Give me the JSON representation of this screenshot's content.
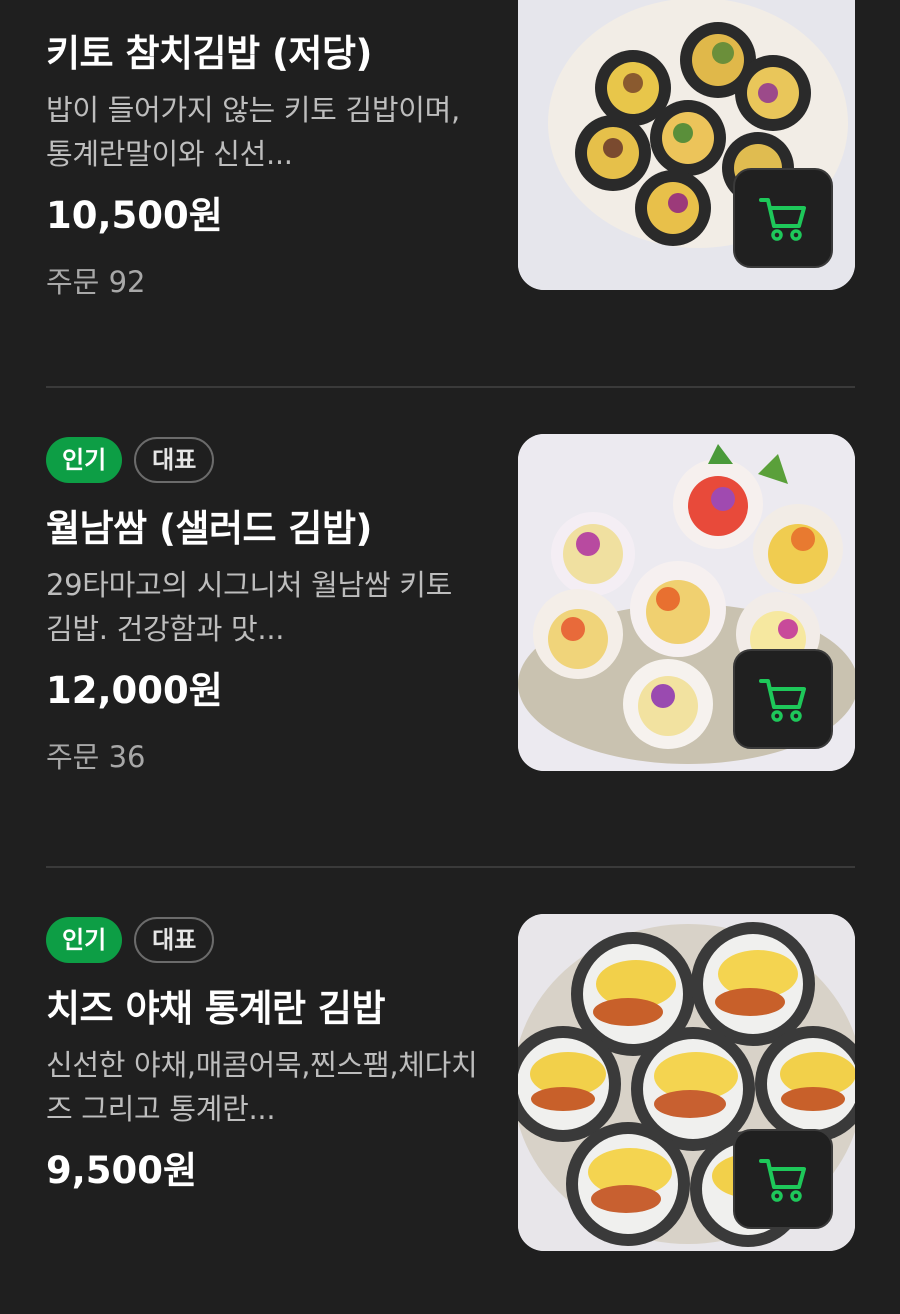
{
  "items": [
    {
      "name": "키토 참치김밥 (저당)",
      "description": "밥이 들어가지 않는 키토 김밥이며, 통계란말이와 신선...",
      "price": "10,500원",
      "orders": "주문 92"
    },
    {
      "badges": [
        "인기",
        "대표"
      ],
      "name": "월남쌈 (샐러드 김밥)",
      "description": "29타마고의 시그니처 월남쌈 키토 김밥. 건강함과 맛...",
      "price": "12,000원",
      "orders": "주문 36"
    },
    {
      "badges": [
        "인기",
        "대표"
      ],
      "name": "치즈 야채 통계란 김밥",
      "description": "신선한 야채,매콤어묵,찐스팸,체다치즈 그리고 통계란...",
      "price": "9,500원"
    }
  ],
  "icons": {
    "cart": "shopping-cart-icon"
  },
  "colors": {
    "accent": "#0d9e45",
    "cart_icon": "#1ec85a",
    "background": "#1f1f1f"
  }
}
